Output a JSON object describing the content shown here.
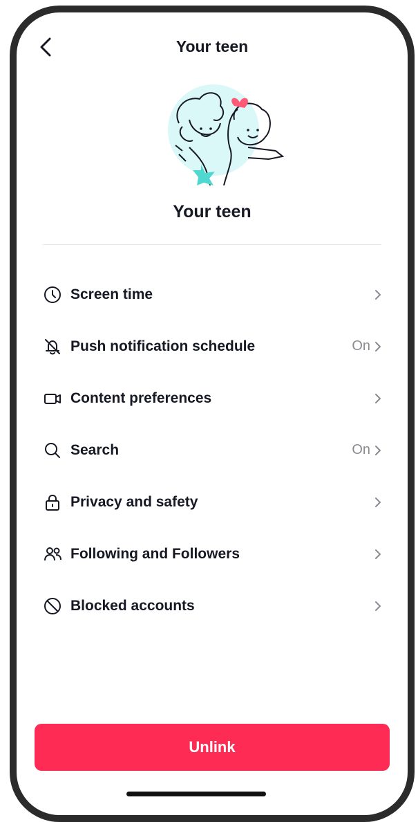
{
  "header": {
    "title": "Your teen"
  },
  "profile": {
    "name": "Your teen"
  },
  "menu": {
    "items": [
      {
        "label": "Screen time",
        "value": "",
        "icon": "clock-icon"
      },
      {
        "label": "Push notification schedule",
        "value": "On",
        "icon": "bell-off-icon"
      },
      {
        "label": "Content preferences",
        "value": "",
        "icon": "video-icon"
      },
      {
        "label": "Search",
        "value": "On",
        "icon": "search-icon"
      },
      {
        "label": "Privacy and safety",
        "value": "",
        "icon": "lock-icon"
      },
      {
        "label": "Following and Followers",
        "value": "",
        "icon": "people-icon"
      },
      {
        "label": "Blocked accounts",
        "value": "",
        "icon": "block-icon"
      }
    ]
  },
  "actions": {
    "unlink_label": "Unlink"
  },
  "colors": {
    "accent": "#fe2c55",
    "illustration_bg": "#d9f8f7",
    "star": "#4fd8cf",
    "bow": "#fe5a78"
  }
}
